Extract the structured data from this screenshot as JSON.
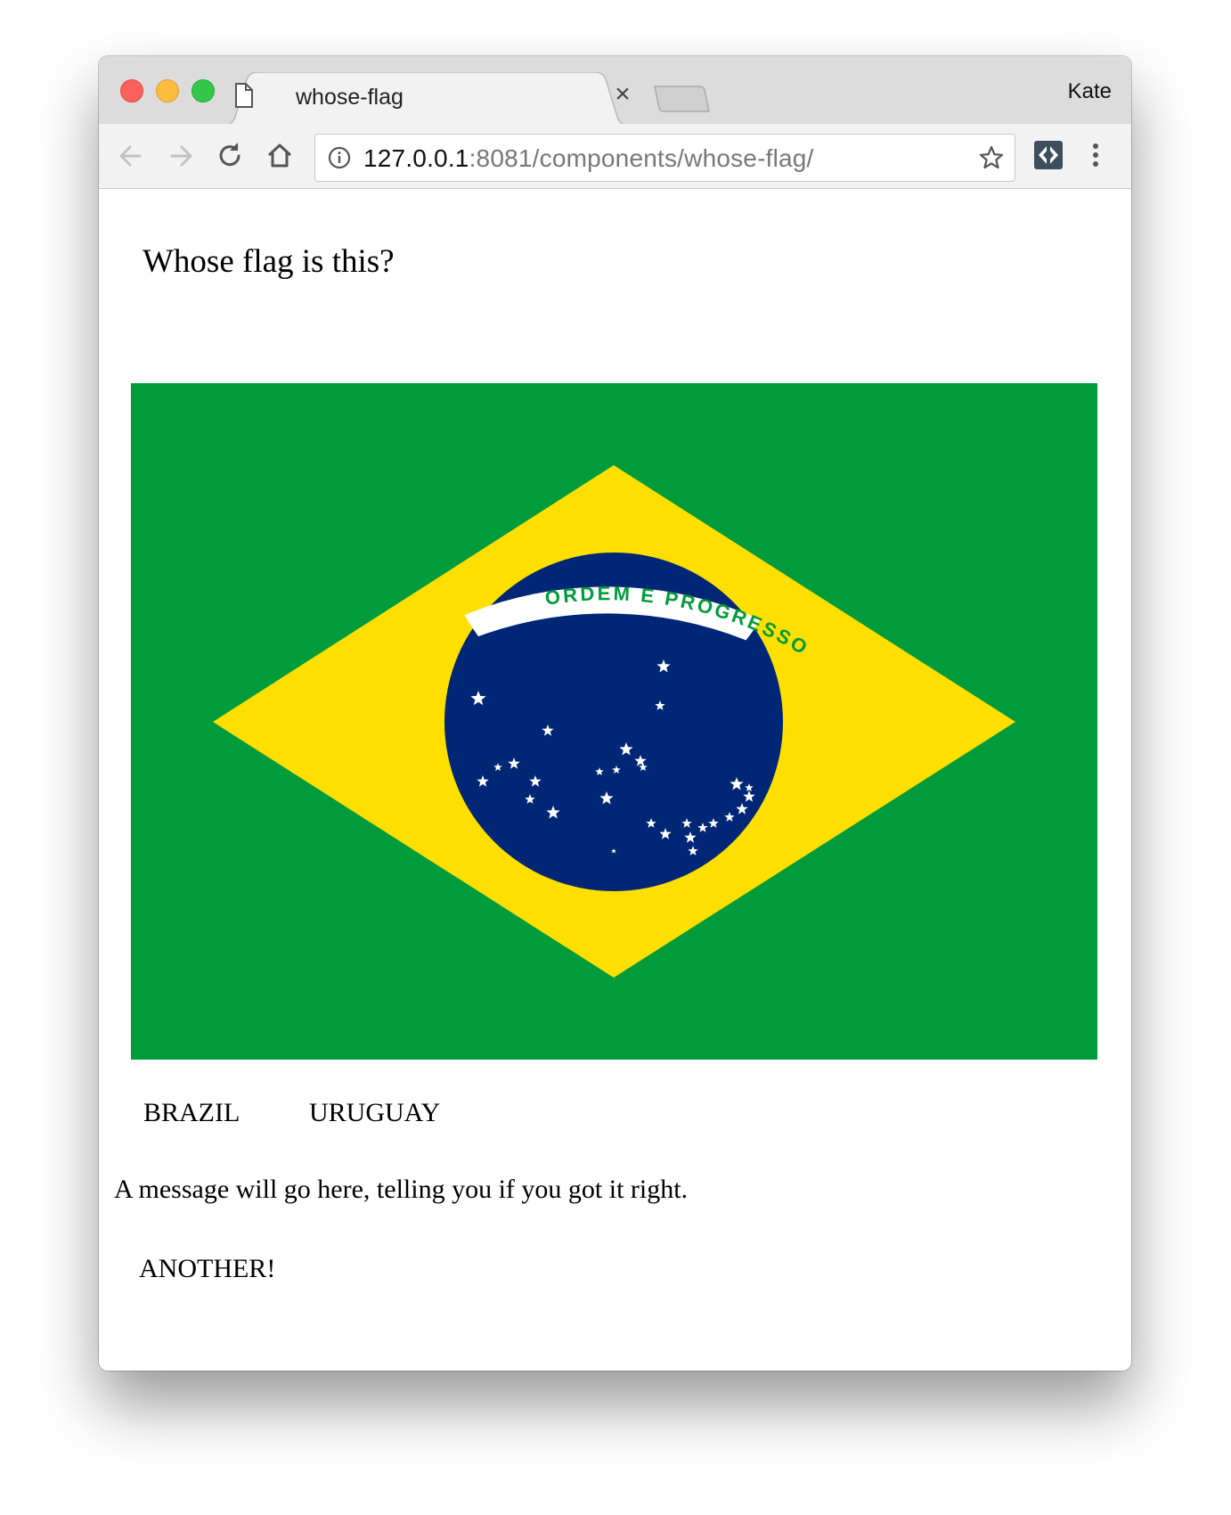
{
  "browser": {
    "tab_title": "whose-flag",
    "profile_name": "Kate",
    "url_host": "127.0.0.1",
    "url_rest": ":8081/components/whose-flag/",
    "icons": [
      "page-icon",
      "close-icon",
      "back-icon",
      "forward-icon",
      "reload-icon",
      "home-icon",
      "info-icon",
      "bookmark-star-icon",
      "extension-icon",
      "menu-icon"
    ]
  },
  "page": {
    "title": "Whose flag is this?",
    "flag": {
      "motto": "ORDEM E PROGRESSO",
      "colors": {
        "green": "#009b3a",
        "yellow": "#fedf00",
        "blue": "#002776",
        "white": "#ffffff"
      }
    },
    "choices": [
      "BRAZIL",
      "URUGUAY"
    ],
    "message": "A message will go here, telling you if you got it right.",
    "another_label": "ANOTHER!"
  }
}
